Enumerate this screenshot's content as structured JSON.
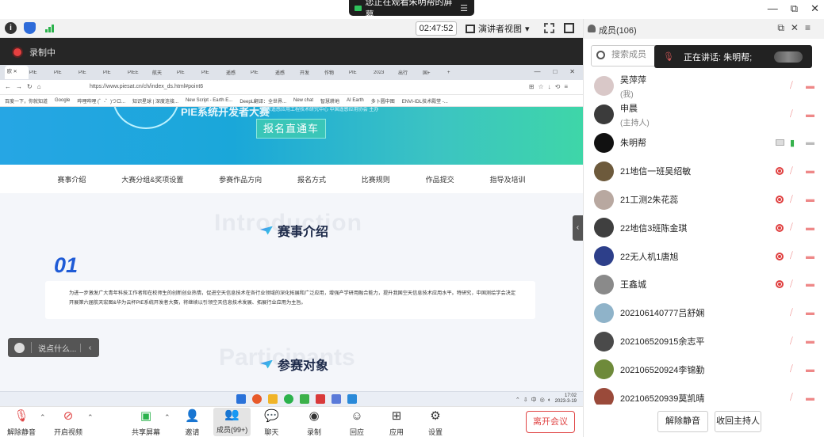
{
  "window": {
    "watching_text": "您正在观看朱明帮的屏幕",
    "controls": [
      "—",
      "⧉",
      "✕"
    ]
  },
  "meeting_bar": {
    "timer": "02:47:52",
    "view_mode": "演讲者视图"
  },
  "recording": {
    "label": "录制中"
  },
  "browser": {
    "tabs": [
      "欧 ✕",
      "PIE",
      "PIE",
      "PIE",
      "PIE",
      "PIEE",
      "航天",
      "PIE",
      "PIE",
      "遥感",
      "PIE",
      "遥感",
      "开发",
      "作物",
      "PIE",
      "2023",
      "出行",
      "国+",
      "+"
    ],
    "url": "https://www.piesat.cn/ch/index_ds.html#point6",
    "bookmarks": [
      "百度一下，你就知道",
      "Google",
      "哔哩哔哩 (゜-゜)つロ...",
      "知识星球 | 深度连接...",
      "New Script - Earth E...",
      "DeepL翻译：全世界...",
      "New chat",
      "智慧耕地",
      "AI Earth",
      "多卜圆中图",
      "ENVI-IDL技术殿堂 -..."
    ]
  },
  "page": {
    "hero_title": "PIE系统开发者大赛",
    "hero_sub": "国家遥感应用工程技术研究中心 中国遥感应用协会 主办",
    "signup_button": "报名直通车",
    "subnav": [
      "赛事介绍",
      "大赛分组&奖项设置",
      "参赛作品方向",
      "报名方式",
      "比赛规则",
      "作品提交",
      "指导及培训"
    ],
    "intro_bg": "Introduction",
    "intro_title": "赛事介绍",
    "section_number": "01",
    "intro_text": "为进一步激发广大青年科技工作者和在校师生的创新创业热情，促进空天信息技术在各行业领域的深化拓展和广泛应用，增强产学研用融合能力，提升我国空天信息技术应用水平。特研究，中国测绘学会决定开展第六届航天宏图&华为云杯PIE系统开发者大赛，将继续以引领空天信息技术发展、拓展行业应用为主旨。",
    "part_bg": "Participants",
    "part_title": "参赛对象"
  },
  "taskbar": {
    "time": "17:02",
    "date": "2023-3-19"
  },
  "chat_input": {
    "placeholder": "说点什么..."
  },
  "controls": {
    "mute": "解除静音",
    "video": "开启视频",
    "share": "共享屏幕",
    "invite": "邀请",
    "members": "成员(99+)",
    "chat": "聊天",
    "record": "录制",
    "react": "回应",
    "apps": "应用",
    "settings": "设置",
    "leave": "离开会议"
  },
  "panel": {
    "title": "成员(106)",
    "search_placeholder": "搜索成员",
    "speaking_tip": "正在讲话: 朱明帮;",
    "members": [
      {
        "name": "吴萍萍",
        "role": "(我)",
        "rec": false,
        "mic": "off",
        "avatar": "#d9c8c8"
      },
      {
        "name": "申晨",
        "role": "(主持人)",
        "rec": false,
        "mic": "off",
        "avatar": "#3b3b3b"
      },
      {
        "name": "朱明帮",
        "role": "",
        "rec": false,
        "mic": "on",
        "avatar": "#111111",
        "sharing": true
      },
      {
        "name": "21地信一班吴绍敏",
        "role": "",
        "rec": true,
        "mic": "off",
        "avatar": "#6d5a3c"
      },
      {
        "name": "21工测2朱花蕊",
        "role": "",
        "rec": true,
        "mic": "off",
        "avatar": "#b8a8a0"
      },
      {
        "name": "22地信3班陈金琪",
        "role": "",
        "rec": true,
        "mic": "off",
        "avatar": "#3f3f3f"
      },
      {
        "name": "22无人机1唐旭",
        "role": "",
        "rec": true,
        "mic": "off",
        "avatar": "#2d3f8a"
      },
      {
        "name": "王鑫城",
        "role": "",
        "rec": true,
        "mic": "off",
        "avatar": "#8a8a8a"
      },
      {
        "name": "202106140777吕舒娴",
        "role": "",
        "rec": false,
        "mic": "off",
        "avatar": "#8fb3c9"
      },
      {
        "name": "202106520915余志平",
        "role": "",
        "rec": false,
        "mic": "off",
        "avatar": "#4a4a4a"
      },
      {
        "name": "202106520924李锦勤",
        "role": "",
        "rec": false,
        "mic": "off",
        "avatar": "#6e8a3a"
      },
      {
        "name": "202106520939莫凯晴",
        "role": "",
        "rec": false,
        "mic": "off",
        "avatar": "#9a4a3a"
      }
    ],
    "unmute_all": "解除静音",
    "reclaim_host": "收回主持人"
  }
}
